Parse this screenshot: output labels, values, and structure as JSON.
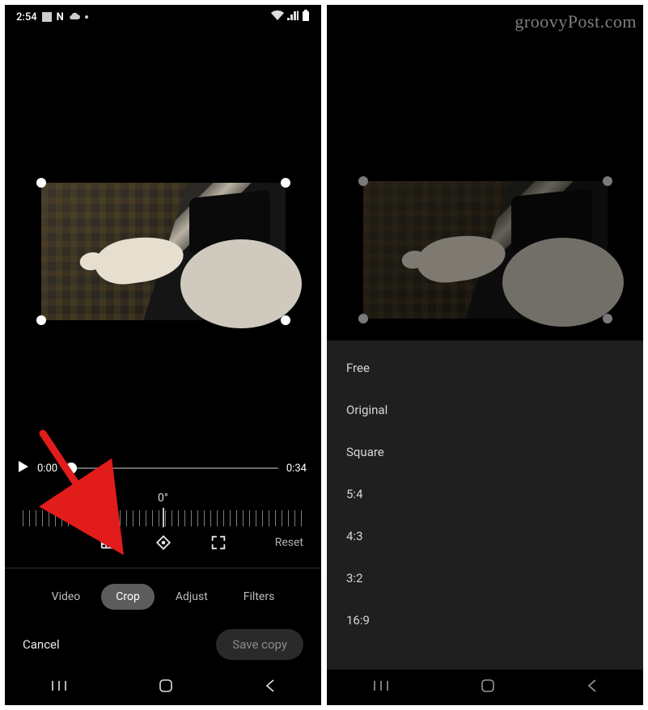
{
  "watermark": "groovyPost.com",
  "left": {
    "statusbar": {
      "time": "2:54",
      "icons_left": [
        "image-icon",
        "netflix-icon",
        "cloud-icon",
        "dot"
      ],
      "icons_right": [
        "wifi-icon",
        "signal-icon",
        "battery-icon"
      ]
    },
    "video": {
      "current_time": "0:00",
      "total_time": "0:34",
      "rotation": "0°"
    },
    "tools": {
      "reset_label": "Reset"
    },
    "tabs": {
      "items": [
        "Video",
        "Crop",
        "Adjust",
        "Filters"
      ],
      "active_index": 1
    },
    "actions": {
      "cancel_label": "Cancel",
      "save_label": "Save copy"
    },
    "nav": [
      "recent",
      "home",
      "back"
    ]
  },
  "right": {
    "aspect_menu": {
      "options": [
        "Free",
        "Original",
        "Square",
        "5:4",
        "4:3",
        "3:2",
        "16:9"
      ]
    },
    "nav": [
      "recent",
      "home",
      "back"
    ]
  }
}
